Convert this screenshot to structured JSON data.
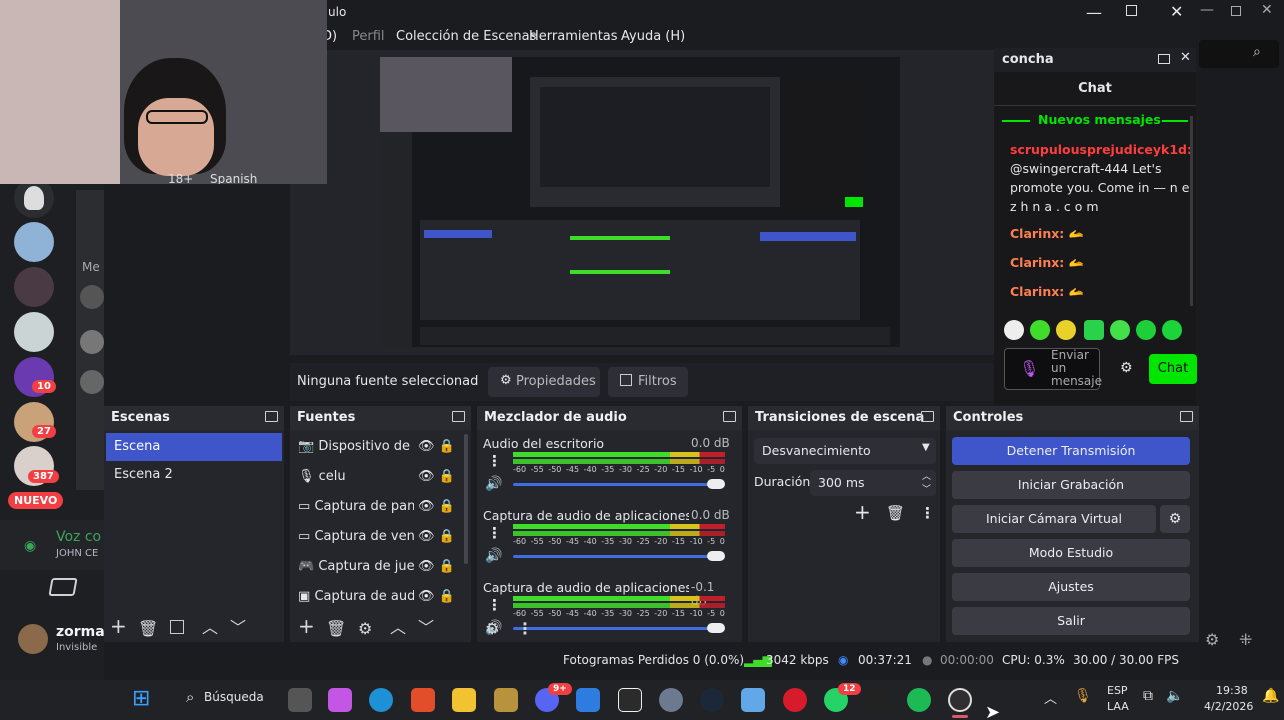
{
  "window": {
    "title_fragment": "ulo"
  },
  "menu": {
    "items": [
      "D)",
      "Perfil",
      "Colección de Escenas",
      "Herramientas",
      "Ayuda (H)"
    ]
  },
  "left_sidebar": {
    "badges": [
      "10",
      "27",
      "387"
    ],
    "new_badge": "NUEVO",
    "voice_label": "Voz co",
    "voice_sub": "JOHN CE",
    "user_name": "zorman",
    "user_status": "Invisible",
    "partial": "Me"
  },
  "webcam": {
    "tags": [
      "18+",
      "Spanish"
    ]
  },
  "preview_bar": {
    "no_source": "Ninguna fuente seleccionad",
    "properties": "Propiedades",
    "filters": "Filtros"
  },
  "scenes": {
    "title": "Escenas",
    "items": [
      "Escena",
      "Escena 2"
    ]
  },
  "sources": {
    "title": "Fuentes",
    "items": [
      "Dispositivo de c",
      "celu",
      "Captura de pant",
      "Captura de vent",
      "Captura de jueg",
      "Captura de audi"
    ]
  },
  "mixer": {
    "title": "Mezclador de audio",
    "channels": [
      {
        "name": "Audio del escritorio",
        "db": "0.0 dB"
      },
      {
        "name": "Captura de audio de aplicaciones (BE",
        "db": "0.0 dB"
      },
      {
        "name": "Captura de audio de aplicaciones (BE",
        "db": "-0.1 dB"
      }
    ],
    "scale": [
      "-60",
      "-55",
      "-50",
      "-45",
      "-40",
      "-35",
      "-30",
      "-25",
      "-20",
      "-15",
      "-10",
      "-5",
      "0"
    ]
  },
  "transitions": {
    "title": "Transiciones de escena",
    "selected": "Desvanecimiento",
    "duration_label": "Duración",
    "duration_value": "300 ms"
  },
  "controls": {
    "title": "Controles",
    "stop": "Detener Transmisión",
    "record": "Iniciar Grabación",
    "virtual_cam": "Iniciar Cámara Virtual",
    "studio": "Modo Estudio",
    "settings": "Ajustes",
    "exit": "Salir"
  },
  "status": {
    "dropped": "Fotogramas Perdidos 0 (0.0%)",
    "bitrate": "3042 kbps",
    "stream_time": "00:37:21",
    "rec_time": "00:00:00",
    "cpu": "CPU: 0.3%",
    "fps": "30.00 / 30.00 FPS"
  },
  "chat": {
    "title": "concha",
    "header": "Chat",
    "new_messages": "Nuevos mensajes",
    "messages": [
      {
        "user": "scrupulousprejudiceyk1d:",
        "text": "@swingercraft-444 Let's promote you. Come in — n e z h n a . c o m"
      },
      {
        "user": "Clarinx:",
        "text": ""
      },
      {
        "user": "Clarinx:",
        "text": ""
      },
      {
        "user": "Clarinx:",
        "text": ""
      }
    ],
    "input_placeholder": "Enviar un mensaje",
    "send_label": "Chat"
  },
  "taskbar": {
    "search": "Búsqueda",
    "lang1": "ESP",
    "lang2": "LAA",
    "time": "19:38",
    "date": "4/2/2026",
    "discord_badge": "9+",
    "whatsapp_badge": "12"
  },
  "colors": {
    "accent": "#3e56c9",
    "twitch_green": "#00e600",
    "meter_green": "#3fdc2a",
    "meter_yellow": "#d6c21a",
    "meter_red": "#c11f2a"
  }
}
